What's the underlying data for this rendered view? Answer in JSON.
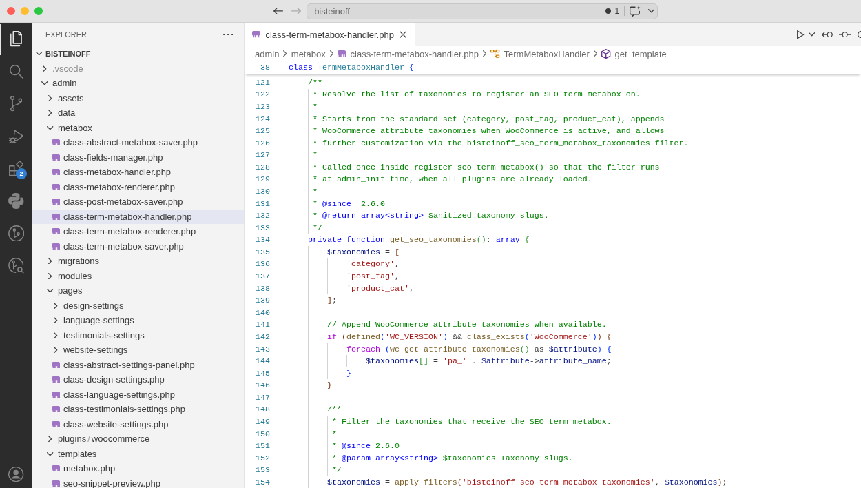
{
  "title_bar": {
    "navigation": [
      {
        "kind": "back",
        "disabled": false
      },
      {
        "kind": "forward",
        "disabled": true
      }
    ],
    "command_center": {
      "label": "bisteinoff",
      "count": "1"
    }
  },
  "activity_bar": {
    "items": [
      {
        "kind": "files",
        "selected": true
      },
      {
        "kind": "search",
        "selected": false
      },
      {
        "kind": "source-control",
        "selected": false
      },
      {
        "kind": "run-debug",
        "selected": false
      },
      {
        "kind": "extensions",
        "selected": false,
        "badge": "2"
      },
      {
        "kind": "python",
        "selected": false
      },
      {
        "kind": "git-graph",
        "selected": false
      },
      {
        "kind": "inspect",
        "selected": false
      }
    ]
  },
  "sidebar": {
    "title": "EXPLORER",
    "root": {
      "label": "BISTEINOFF",
      "expanded": true,
      "children": [
        {
          "kind": "folder",
          "label": ".vscode",
          "expanded": false,
          "selected": false,
          "dimmed": true
        },
        {
          "kind": "folder",
          "label": "admin",
          "expanded": true,
          "selected": false,
          "dimmed": false,
          "indent_guide": false,
          "children": [
            {
              "kind": "folder",
              "label": "assets",
              "expanded": false,
              "selected": false,
              "dimmed": false
            },
            {
              "kind": "folder",
              "label": "data",
              "expanded": false,
              "selected": false,
              "dimmed": false
            },
            {
              "kind": "folder",
              "label": "metabox",
              "expanded": true,
              "selected": false,
              "dimmed": false,
              "indent_guide": true,
              "children": [
                {
                  "kind": "file",
                  "label": "class-abstract-metabox-saver.php",
                  "selected": false,
                  "dimmed": false
                },
                {
                  "kind": "file",
                  "label": "class-fields-manager.php",
                  "selected": false,
                  "dimmed": false
                },
                {
                  "kind": "file",
                  "label": "class-metabox-handler.php",
                  "selected": false,
                  "dimmed": false
                },
                {
                  "kind": "file",
                  "label": "class-metabox-renderer.php",
                  "selected": false,
                  "dimmed": false
                },
                {
                  "kind": "file",
                  "label": "class-post-metabox-saver.php",
                  "selected": false,
                  "dimmed": false
                },
                {
                  "kind": "file",
                  "label": "class-term-metabox-handler.php",
                  "selected": true,
                  "dimmed": false
                },
                {
                  "kind": "file",
                  "label": "class-term-metabox-renderer.php",
                  "selected": false,
                  "dimmed": false
                },
                {
                  "kind": "file",
                  "label": "class-term-metabox-saver.php",
                  "selected": false,
                  "dimmed": false
                }
              ]
            },
            {
              "kind": "folder",
              "label": "migrations",
              "expanded": false,
              "selected": false,
              "dimmed": false
            },
            {
              "kind": "folder",
              "label": "modules",
              "expanded": false,
              "selected": false,
              "dimmed": false
            },
            {
              "kind": "folder",
              "label": "pages",
              "expanded": true,
              "selected": false,
              "dimmed": false,
              "indent_guide": false,
              "children": [
                {
                  "kind": "folder",
                  "label": "design-settings",
                  "expanded": false,
                  "selected": false,
                  "dimmed": false
                },
                {
                  "kind": "folder",
                  "label": "language-settings",
                  "expanded": false,
                  "selected": false,
                  "dimmed": false
                },
                {
                  "kind": "folder",
                  "label": "testimonials-settings",
                  "expanded": false,
                  "selected": false,
                  "dimmed": false
                },
                {
                  "kind": "folder",
                  "label": "website-settings",
                  "expanded": false,
                  "selected": false,
                  "dimmed": false
                },
                {
                  "kind": "file",
                  "label": "class-abstract-settings-panel.php",
                  "selected": false,
                  "dimmed": false
                },
                {
                  "kind": "file",
                  "label": "class-design-settings.php",
                  "selected": false,
                  "dimmed": false
                },
                {
                  "kind": "file",
                  "label": "class-language-settings.php",
                  "selected": false,
                  "dimmed": false
                },
                {
                  "kind": "file",
                  "label": "class-testimonials-settings.php",
                  "selected": false,
                  "dimmed": false
                },
                {
                  "kind": "file",
                  "label": "class-website-settings.php",
                  "selected": false,
                  "dimmed": false
                }
              ]
            },
            {
              "kind": "folder",
              "labels": [
                "plugins",
                "woocommerce"
              ],
              "separator": "/",
              "expanded": false,
              "selected": false,
              "dimmed": false
            },
            {
              "kind": "folder",
              "label": "templates",
              "expanded": true,
              "selected": false,
              "dimmed": false,
              "indent_guide": true,
              "children": [
                {
                  "kind": "file",
                  "label": "metabox.php",
                  "selected": false,
                  "dimmed": false
                },
                {
                  "kind": "file",
                  "label": "seo-snippet-preview.php",
                  "selected": false,
                  "dimmed": false
                }
              ]
            }
          ]
        }
      ]
    }
  },
  "editor": {
    "tabs": [
      {
        "label": "class-term-metabox-handler.php",
        "selected": true
      }
    ],
    "breadcrumbs": [
      {
        "kind": "folder",
        "label": "admin"
      },
      {
        "kind": "folder",
        "label": "metabox"
      },
      {
        "kind": "file",
        "label": "class-term-metabox-handler.php"
      },
      {
        "kind": "class",
        "label": "TermMetaboxHandler"
      },
      {
        "kind": "method",
        "label": "get_template"
      }
    ],
    "sticky_line": {
      "number": "38",
      "tokens": [
        {
          "kind": "keyword",
          "text": "class "
        },
        {
          "kind": "class",
          "text": "TermMetaboxHandler "
        },
        {
          "kind": "bracket1",
          "text": "{"
        }
      ]
    },
    "lines": [
      {
        "number": "121",
        "tokens": [
          {
            "kind": "comment",
            "text": "    /**"
          }
        ]
      },
      {
        "number": "122",
        "tokens": [
          {
            "kind": "comment",
            "text": "     * Resolve the list of taxonomies to register an SEO term metabox on."
          }
        ]
      },
      {
        "number": "123",
        "tokens": [
          {
            "kind": "comment",
            "text": "     *"
          }
        ]
      },
      {
        "number": "124",
        "tokens": [
          {
            "kind": "comment",
            "text": "     * Starts from the standard set (category, post_tag, product_cat), appends"
          }
        ]
      },
      {
        "number": "125",
        "tokens": [
          {
            "kind": "comment",
            "text": "     * WooCommerce attribute taxonomies when WooCommerce is active, and allows"
          }
        ]
      },
      {
        "number": "126",
        "tokens": [
          {
            "kind": "comment",
            "text": "     * further customization via the bisteinoff_seo_term_metabox_taxonomies filter."
          }
        ]
      },
      {
        "number": "127",
        "tokens": [
          {
            "kind": "comment",
            "text": "     *"
          }
        ]
      },
      {
        "number": "128",
        "tokens": [
          {
            "kind": "comment",
            "text": "     * Called once inside register_seo_term_metabox() so that the filter runs"
          }
        ]
      },
      {
        "number": "129",
        "tokens": [
          {
            "kind": "comment",
            "text": "     * at admin_init time, when all plugins are already loaded."
          }
        ]
      },
      {
        "number": "130",
        "tokens": [
          {
            "kind": "comment",
            "text": "     *"
          }
        ]
      },
      {
        "number": "131",
        "tokens": [
          {
            "kind": "comment",
            "text": "     * "
          },
          {
            "kind": "tag",
            "text": "@since"
          },
          {
            "kind": "comment",
            "text": "  2.6.0"
          }
        ]
      },
      {
        "number": "132",
        "tokens": [
          {
            "kind": "comment",
            "text": "     * "
          },
          {
            "kind": "tag",
            "text": "@return "
          },
          {
            "kind": "type",
            "text": "array<string>"
          },
          {
            "kind": "comment",
            "text": " Sanitized taxonomy slugs."
          }
        ]
      },
      {
        "number": "133",
        "tokens": [
          {
            "kind": "comment",
            "text": "     */"
          }
        ]
      },
      {
        "number": "134",
        "tokens": [
          {
            "kind": "keyword",
            "text": "    private function "
          },
          {
            "kind": "function",
            "text": "get_seo_taxonomies"
          },
          {
            "kind": "bracket2",
            "text": "()"
          },
          {
            "kind": "plain",
            "text": ": "
          },
          {
            "kind": "keyword",
            "text": "array "
          },
          {
            "kind": "bracket2",
            "text": "{"
          }
        ]
      },
      {
        "number": "135",
        "tokens": [
          {
            "kind": "variable",
            "text": "        $taxonomies"
          },
          {
            "kind": "plain",
            "text": " = "
          },
          {
            "kind": "bracket3",
            "text": "["
          }
        ]
      },
      {
        "number": "136",
        "tokens": [
          {
            "kind": "string",
            "text": "            'category'"
          },
          {
            "kind": "plain",
            "text": ","
          }
        ]
      },
      {
        "number": "137",
        "tokens": [
          {
            "kind": "string",
            "text": "            'post_tag'"
          },
          {
            "kind": "plain",
            "text": ","
          }
        ]
      },
      {
        "number": "138",
        "tokens": [
          {
            "kind": "string",
            "text": "            'product_cat'"
          },
          {
            "kind": "plain",
            "text": ","
          }
        ]
      },
      {
        "number": "139",
        "tokens": [
          {
            "kind": "bracket3",
            "text": "        ]"
          },
          {
            "kind": "plain",
            "text": ";"
          }
        ]
      },
      {
        "number": "140"
      },
      {
        "number": "141",
        "tokens": [
          {
            "kind": "comment",
            "text": "        // Append WooCommerce attribute taxonomies when available."
          }
        ]
      },
      {
        "number": "142",
        "tokens": [
          {
            "kind": "control",
            "text": "        if "
          },
          {
            "kind": "bracket3",
            "text": "("
          },
          {
            "kind": "function",
            "text": "defined"
          },
          {
            "kind": "bracket1",
            "text": "("
          },
          {
            "kind": "string",
            "text": "'WC_VERSION'"
          },
          {
            "kind": "bracket1",
            "text": ")"
          },
          {
            "kind": "plain",
            "text": " && "
          },
          {
            "kind": "function",
            "text": "class_exists"
          },
          {
            "kind": "bracket1",
            "text": "("
          },
          {
            "kind": "string",
            "text": "'WooCommerce'"
          },
          {
            "kind": "bracket1",
            "text": ")"
          },
          {
            "kind": "bracket3",
            "text": ") {"
          }
        ]
      },
      {
        "number": "143",
        "tokens": [
          {
            "kind": "control",
            "text": "            foreach "
          },
          {
            "kind": "bracket1",
            "text": "("
          },
          {
            "kind": "function",
            "text": "wc_get_attribute_taxonomies"
          },
          {
            "kind": "bracket2",
            "text": "()"
          },
          {
            "kind": "plain",
            "text": " as "
          },
          {
            "kind": "variable",
            "text": "$attribute"
          },
          {
            "kind": "bracket1",
            "text": ") {"
          }
        ]
      },
      {
        "number": "144",
        "tokens": [
          {
            "kind": "variable",
            "text": "                $taxonomies"
          },
          {
            "kind": "bracket2",
            "text": "[]"
          },
          {
            "kind": "plain",
            "text": " = "
          },
          {
            "kind": "string",
            "text": "'pa_'"
          },
          {
            "kind": "plain",
            "text": " . "
          },
          {
            "kind": "variable",
            "text": "$attribute"
          },
          {
            "kind": "plain",
            "text": "->"
          },
          {
            "kind": "variable",
            "text": "attribute_name"
          },
          {
            "kind": "plain",
            "text": ";"
          }
        ]
      },
      {
        "number": "145",
        "tokens": [
          {
            "kind": "bracket1",
            "text": "            }"
          }
        ]
      },
      {
        "number": "146",
        "tokens": [
          {
            "kind": "bracket3",
            "text": "        }"
          }
        ]
      },
      {
        "number": "147"
      },
      {
        "number": "148",
        "tokens": [
          {
            "kind": "comment",
            "text": "        /**"
          }
        ]
      },
      {
        "number": "149",
        "tokens": [
          {
            "kind": "comment",
            "text": "         * Filter the taxonomies that receive the SEO term metabox."
          }
        ]
      },
      {
        "number": "150",
        "tokens": [
          {
            "kind": "comment",
            "text": "         *"
          }
        ]
      },
      {
        "number": "151",
        "tokens": [
          {
            "kind": "comment",
            "text": "         * "
          },
          {
            "kind": "tag",
            "text": "@since"
          },
          {
            "kind": "comment",
            "text": " 2.6.0"
          }
        ]
      },
      {
        "number": "152",
        "tokens": [
          {
            "kind": "comment",
            "text": "         * "
          },
          {
            "kind": "tag",
            "text": "@param "
          },
          {
            "kind": "type",
            "text": "array<string>"
          },
          {
            "kind": "comment",
            "text": " $taxonomies Taxonomy slugs."
          }
        ]
      },
      {
        "number": "153",
        "tokens": [
          {
            "kind": "comment",
            "text": "         */"
          }
        ]
      },
      {
        "number": "154",
        "tokens": [
          {
            "kind": "variable",
            "text": "        $taxonomies"
          },
          {
            "kind": "plain",
            "text": " = "
          },
          {
            "kind": "function",
            "text": "apply_filters"
          },
          {
            "kind": "bracket3",
            "text": "("
          },
          {
            "kind": "string",
            "text": "'bisteinoff_seo_term_metabox_taxonomies'"
          },
          {
            "kind": "plain",
            "text": ", "
          },
          {
            "kind": "variable",
            "text": "$taxonomies"
          },
          {
            "kind": "bracket3",
            "text": ")"
          },
          {
            "kind": "plain",
            "text": ";"
          }
        ]
      }
    ]
  }
}
